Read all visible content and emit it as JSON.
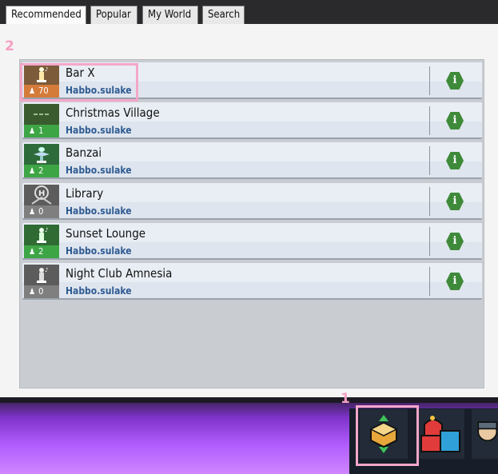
{
  "tabs": [
    {
      "label": "Recommended",
      "active": true
    },
    {
      "label": "Popular",
      "active": false
    },
    {
      "label": "My World",
      "active": false
    },
    {
      "label": "Search",
      "active": false
    }
  ],
  "markers": {
    "list_step": "2",
    "toolbar_step": "1"
  },
  "rooms": [
    {
      "name": "Bar X",
      "owner": "Habbo.sulake",
      "users": "70",
      "badge_color": "#d57b3a",
      "thumb_color": "#7b5b3a",
      "thumb_icon": "statue-icon"
    },
    {
      "name": "Christmas Village",
      "owner": "Habbo.sulake",
      "users": "1",
      "badge_color": "#3ea545",
      "thumb_color": "#3a5b2e",
      "thumb_icon": "dots-icon"
    },
    {
      "name": "Banzai",
      "owner": "Habbo.sulake",
      "users": "2",
      "badge_color": "#3ea545",
      "thumb_color": "#2e6b3a",
      "thumb_icon": "frog-icon"
    },
    {
      "name": "Library",
      "owner": "Habbo.sulake",
      "users": "0",
      "badge_color": "#7f7f7f",
      "thumb_color": "#5c5c5c",
      "thumb_icon": "crest-icon"
    },
    {
      "name": "Sunset Lounge",
      "owner": "Habbo.sulake",
      "users": "2",
      "badge_color": "#3ea545",
      "thumb_color": "#2f6b33",
      "thumb_icon": "statue-icon"
    },
    {
      "name": "Night Club Amnesia",
      "owner": "Habbo.sulake",
      "users": "0",
      "badge_color": "#7f7f7f",
      "thumb_color": "#5c5c5c",
      "thumb_icon": "statue-icon"
    }
  ],
  "info_label": "i",
  "toolbar": {
    "buttons": [
      "navigator-icon",
      "shop-icon",
      "avatar-icon"
    ]
  }
}
